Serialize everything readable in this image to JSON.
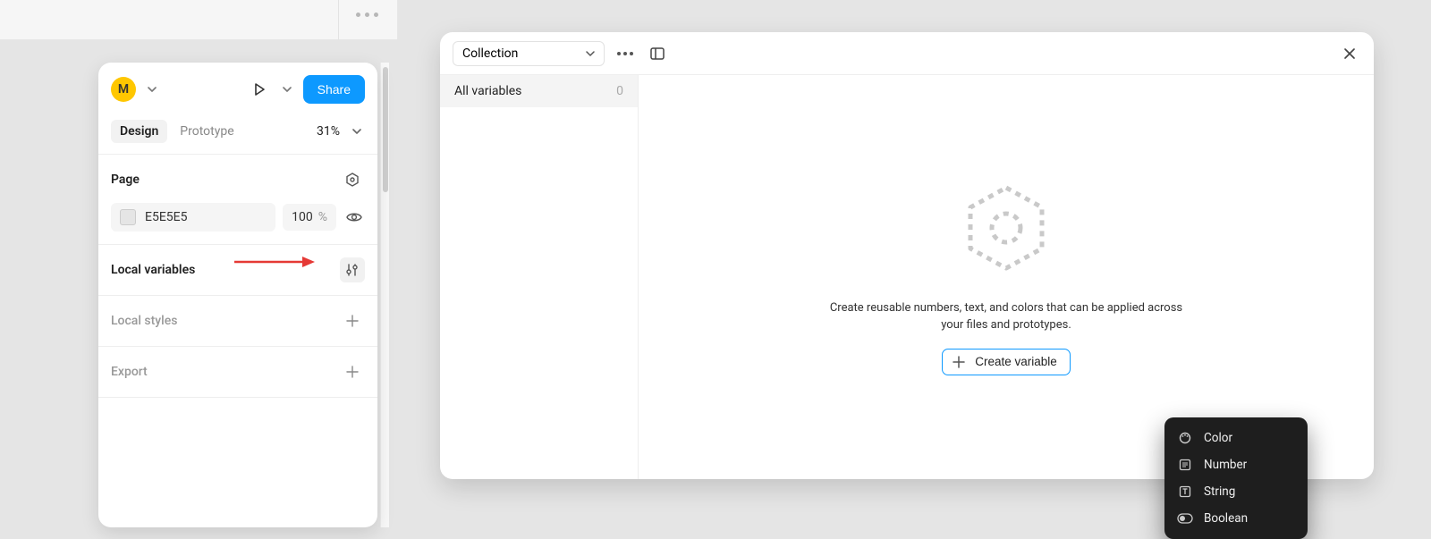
{
  "inspector": {
    "avatar_initial": "M",
    "share_label": "Share",
    "tabs": {
      "design": "Design",
      "prototype": "Prototype"
    },
    "zoom_label": "31%",
    "sections": {
      "page": {
        "title": "Page",
        "fill_hex": "E5E5E5",
        "opacity_value": "100",
        "opacity_unit": "%"
      },
      "local_variables": {
        "title": "Local variables"
      },
      "local_styles": {
        "title": "Local styles"
      },
      "export": {
        "title": "Export"
      }
    }
  },
  "variables_panel": {
    "collection_label": "Collection",
    "sidebar": {
      "all_variables_label": "All variables",
      "all_variables_count": "0"
    },
    "empty_text": "Create reusable numbers, text, and colors that can be applied across your files and prototypes.",
    "create_button_label": "Create variable",
    "type_menu": {
      "color": "Color",
      "number": "Number",
      "string": "String",
      "boolean": "Boolean"
    }
  }
}
